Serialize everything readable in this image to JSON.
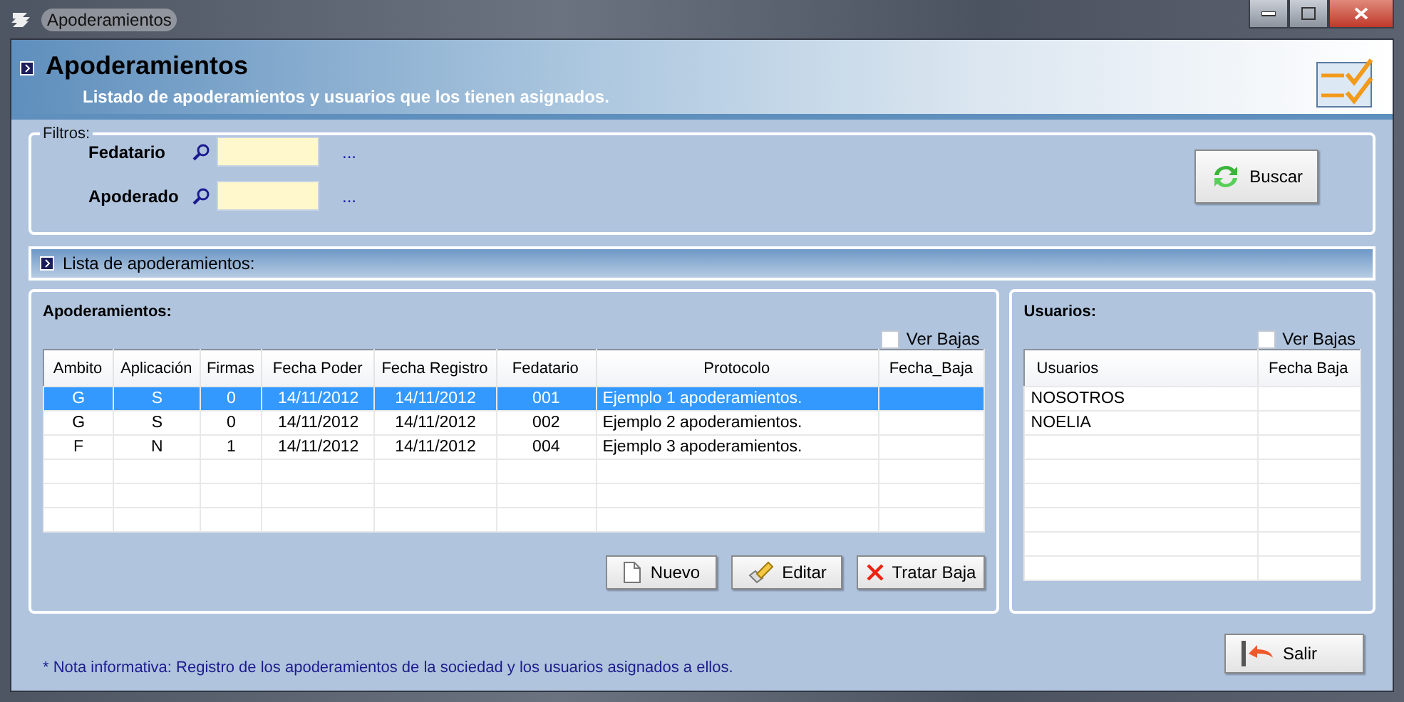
{
  "window": {
    "title": "Apoderamientos"
  },
  "header": {
    "title": "Apoderamientos",
    "subtitle": "Listado de apoderamientos y usuarios que los tienen asignados."
  },
  "filters": {
    "legend": "Filtros:",
    "fields": [
      {
        "label": "Fedatario",
        "ellipsis": "..."
      },
      {
        "label": "Apoderado",
        "ellipsis": "..."
      }
    ],
    "search_button": "Buscar"
  },
  "list_bar": {
    "title": "Lista de apoderamientos:"
  },
  "apoderamientos": {
    "title": "Apoderamientos:",
    "ver_bajas": {
      "label": "Ver Bajas",
      "checked": false
    },
    "columns": [
      "Ambito",
      "Aplicación",
      "Firmas",
      "Fecha Poder",
      "Fecha Registro",
      "Fedatario",
      "Protocolo",
      "Fecha_Baja"
    ],
    "rows": [
      {
        "cells": [
          "G",
          "S",
          "0",
          "14/11/2012",
          "14/11/2012",
          "001",
          "Ejemplo 1 apoderamientos.",
          ""
        ],
        "selected": true
      },
      {
        "cells": [
          "G",
          "S",
          "0",
          "14/11/2012",
          "14/11/2012",
          "002",
          "Ejemplo 2 apoderamientos.",
          ""
        ],
        "selected": false
      },
      {
        "cells": [
          "F",
          "N",
          "1",
          "14/11/2012",
          "14/11/2012",
          "004",
          "Ejemplo 3 apoderamientos.",
          ""
        ],
        "selected": false
      }
    ],
    "buttons": [
      {
        "label": "Nuevo",
        "kind": "new"
      },
      {
        "label": "Editar",
        "kind": "edit"
      },
      {
        "label": "Tratar Baja",
        "kind": "delete"
      }
    ]
  },
  "usuarios": {
    "title": "Usuarios:",
    "ver_bajas": {
      "label": "Ver Bajas",
      "checked": false
    },
    "columns": [
      "Usuarios",
      "Fecha Baja"
    ],
    "rows": [
      {
        "cells": [
          "NOSOTROS",
          ""
        ],
        "selected": false
      },
      {
        "cells": [
          "NOELIA",
          ""
        ],
        "selected": false
      }
    ]
  },
  "note": "* Nota informativa: Registro de los apoderamientos de la sociedad y los usuarios asignados a ellos.",
  "exit_button": "Salir"
}
